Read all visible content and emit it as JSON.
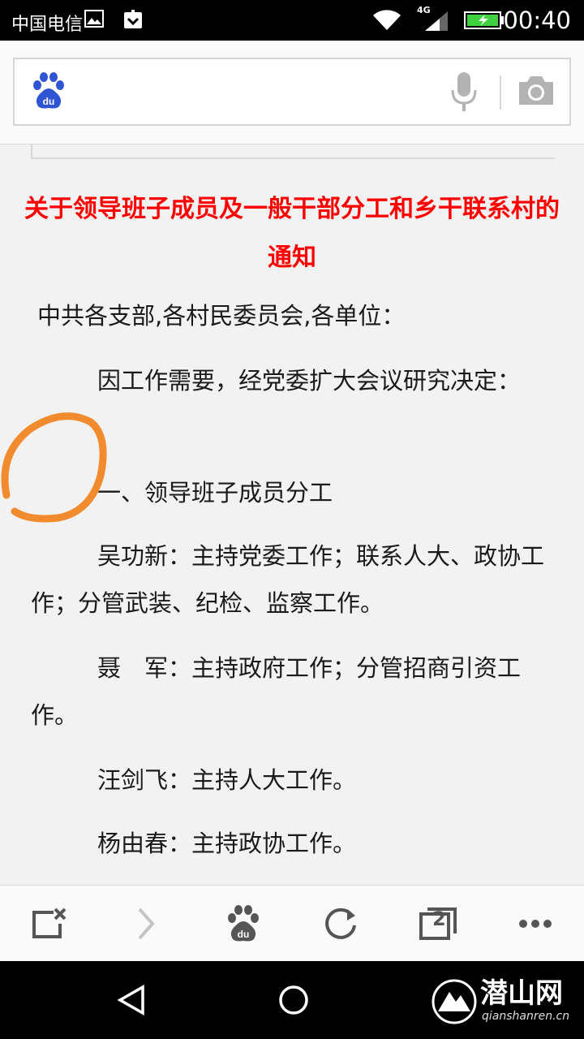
{
  "status_bar": {
    "carrier": "中国电信",
    "network": "4G",
    "time": "00:40"
  },
  "search": {
    "placeholder": "",
    "logo_icon": "baidu-paw-logo",
    "mic_icon": "microphone-icon",
    "camera_icon": "camera-icon"
  },
  "document": {
    "title": "关于领导班子成员及一般干部分工和乡干联系村的通知",
    "salutation": "中共各支部,各村民委员会,各单位：",
    "paragraphs": [
      "因工作需要，经党委扩大会议研究决定：",
      "一、领导班子成员分工",
      "吴功新：主持党委工作；联系人大、政协工作；分管武装、纪检、监察工作。",
      "聂　军：主持政府工作；分管招商引资工作。",
      "汪剑飞：主持人大工作。",
      "杨由春：主持政协工作。"
    ]
  },
  "toolbar": {
    "tab_count": "2"
  },
  "watermark": {
    "name": "潜山网",
    "url": "qianshanren.cn"
  },
  "colors": {
    "title_red": "#ff0000",
    "circle_orange": "#f28a2e",
    "baidu_blue": "#2f55d4",
    "battery_green": "#3fd13f"
  }
}
